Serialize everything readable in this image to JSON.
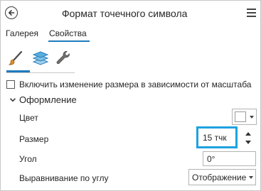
{
  "header": {
    "title": "Формат точечного символа",
    "back_icon": "back-arrow-circle-icon",
    "menu_icon": "hamburger-menu-icon"
  },
  "tabs": [
    {
      "label": "Галерея",
      "active": false
    },
    {
      "label": "Свойства",
      "active": true
    }
  ],
  "tools": [
    {
      "icon": "paintbrush-icon",
      "active": true
    },
    {
      "icon": "layers-icon",
      "active": false
    },
    {
      "icon": "wrench-icon",
      "active": false
    }
  ],
  "scale_option": {
    "label": "Включить изменение размера в зависимости от масштаба",
    "checked": false
  },
  "appearance": {
    "title": "Оформление",
    "expanded": true,
    "color": {
      "label": "Цвет",
      "value": "#ffffff"
    },
    "size": {
      "label": "Размер",
      "value": "15 тчк"
    },
    "angle": {
      "label": "Угол",
      "value": "0°"
    },
    "alignment": {
      "label": "Выравнивание по углу",
      "value": "Отображение"
    }
  },
  "colors": {
    "accent": "#1f7bbd",
    "highlight": "#1ea1e0"
  }
}
